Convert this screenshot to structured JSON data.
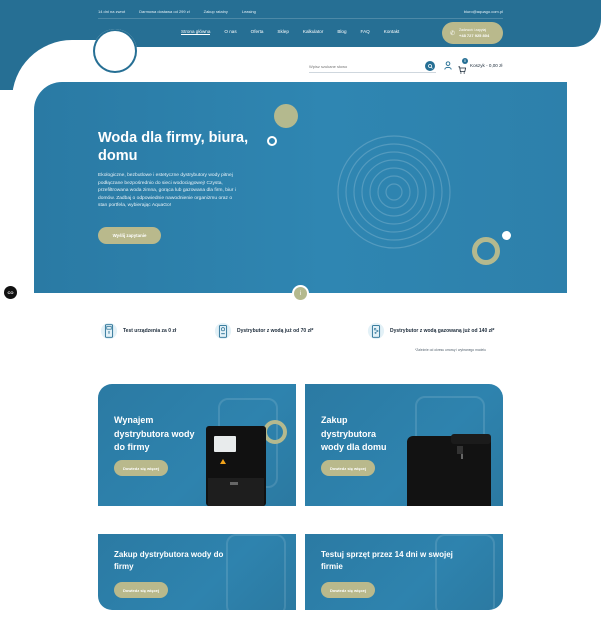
{
  "colors": {
    "primary": "#266f94",
    "hero": "#2f86b2",
    "accent": "#b9b98c",
    "white": "#ffffff",
    "dark": "#1c2b3a"
  },
  "topbar": {
    "items": [
      "14 dni na zwrot",
      "Darmowa dostawa od 299 zł",
      "Zakup ratalny",
      "Leasing"
    ],
    "email": "biuro@aquago.com.pl"
  },
  "nav": {
    "items": [
      "Strona główna",
      "O nas",
      "Oferta",
      "Sklep",
      "Kalkulator",
      "Blog",
      "FAQ",
      "Kontakt"
    ],
    "active": "Strona główna"
  },
  "phone": {
    "label": "Zadzwoń i zapytaj",
    "number": "+48 727 925 804",
    "icon": "phone-icon"
  },
  "search": {
    "placeholder": "Wpisz szukane słowo",
    "icon": "search-icon"
  },
  "cart": {
    "count": "0",
    "label": "Koszyk - 0,00 zł",
    "icon": "cart-icon"
  },
  "hero": {
    "title": "Woda dla firmy, biura, domu",
    "description": "Ekologiczne, bezbutlowe i estetyczne dystrybutory wody pitnej podłączane bezpośrednio do sieci wodociągowej! Czysta, przefiltrowana woda zimna, gorąca lub gazowana dla firm, biur i domów. Zadbaj o odpowiednie nawodnienie organizmu oraz o stan portfela, wybierając AquaGo!",
    "button": "Wyślij zapytanie",
    "slider_label": "i"
  },
  "cookie": {
    "label": "CO"
  },
  "features": [
    {
      "icon": "dispenser-test-icon",
      "text": "Test urządzenia za 0 zł"
    },
    {
      "icon": "dispenser-water-icon",
      "text": "Dystrybutor z wodą już od 70 zł*"
    },
    {
      "icon": "dispenser-sparkling-icon",
      "text": "Dystrybutor z wodą gazowaną już od 140 zł*"
    }
  ],
  "footnote": "*Zależnie od okresu umowy i wybranego modelu",
  "cards": [
    {
      "title": "Wynajem dystrybutora wody do firmy",
      "button": "Dowiedz się więcej"
    },
    {
      "title": "Zakup dystrybutora wody dla domu",
      "button": "Dowiedz się więcej"
    },
    {
      "title": "Zakup dystrybutora wody do firmy",
      "button": "Dowiedz się więcej"
    },
    {
      "title": "Testuj sprzęt przez 14 dni w swojej firmie",
      "button": "Dowiedz się więcej"
    }
  ]
}
